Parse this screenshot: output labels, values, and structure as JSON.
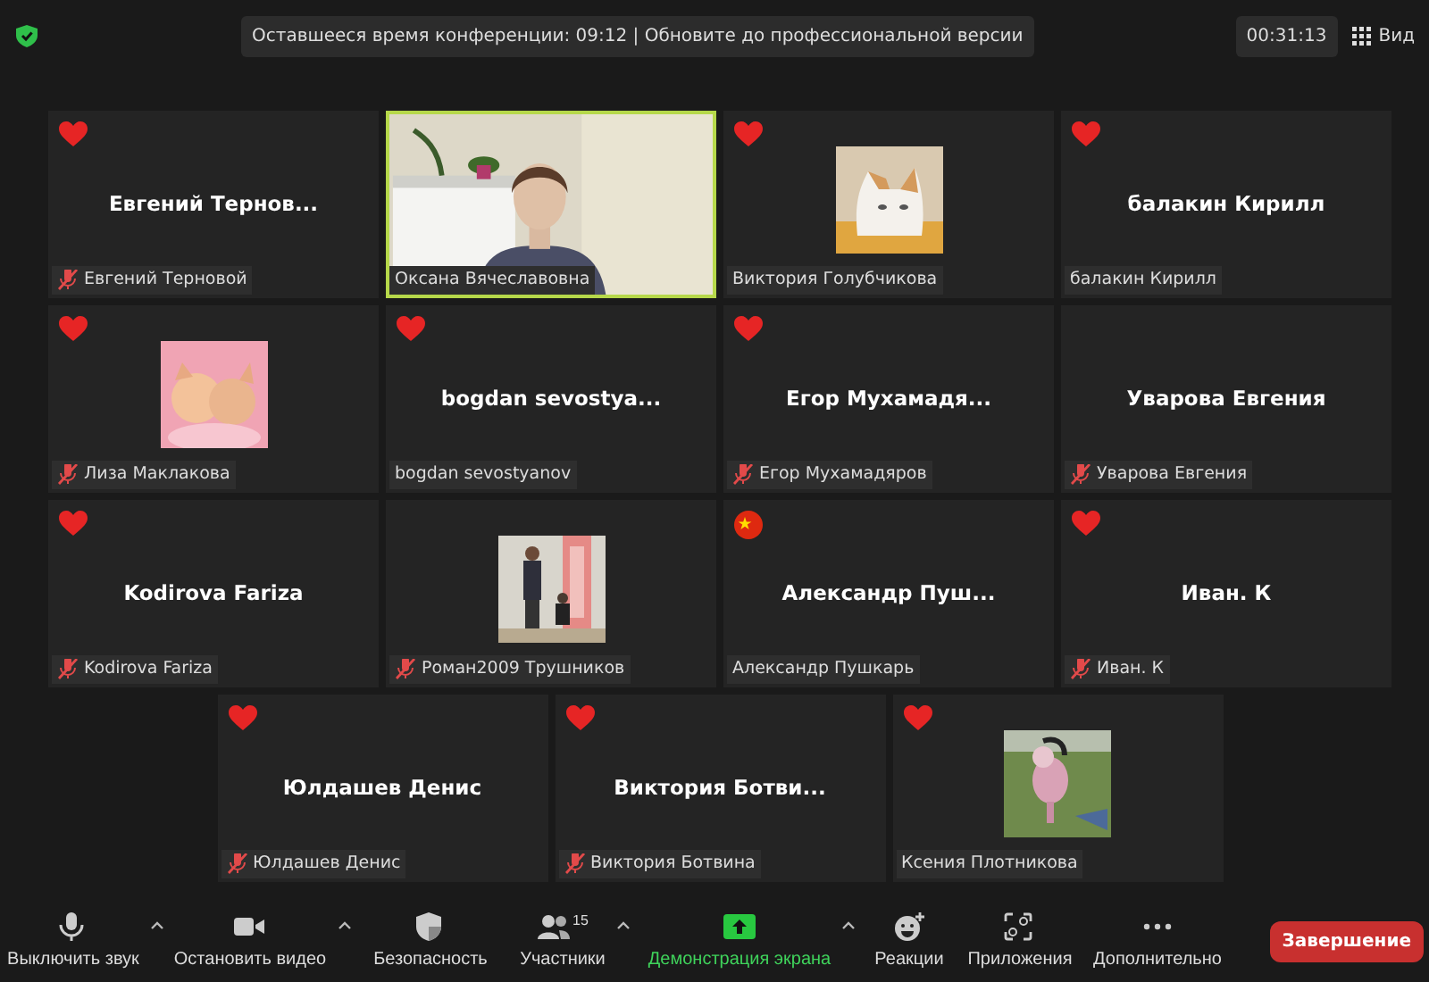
{
  "top_bar": {
    "notice": "Оставшееся время конференции: 09:12 | Обновите до профессиональной версии",
    "timer": "00:31:13",
    "view_label": "Вид"
  },
  "tiles": [
    {
      "kind": "name",
      "display_name": "Евгений  Тернов...",
      "label": "Евгений Терновой",
      "reaction": {
        "kind": "heart"
      },
      "muted": true,
      "selected": false
    },
    {
      "kind": "video",
      "label": "Оксана Вячеславовна",
      "muted": false,
      "selected": true
    },
    {
      "kind": "picture",
      "label": "Виктория Голубчикова",
      "reaction": {
        "kind": "heart"
      },
      "muted": false,
      "selected": false
    },
    {
      "kind": "name",
      "display_name": "балакин Кирилл",
      "label": "балакин Кирилл",
      "reaction": {
        "kind": "heart"
      },
      "muted": false,
      "selected": false
    },
    {
      "kind": "picture",
      "label": "Лиза Маклакова",
      "reaction": {
        "kind": "heart"
      },
      "muted": true,
      "selected": false
    },
    {
      "kind": "name",
      "display_name": "bogdan sevostya...",
      "label": "bogdan sevostyanov",
      "reaction": {
        "kind": "heart"
      },
      "muted": false,
      "selected": false
    },
    {
      "kind": "name",
      "display_name": "Егор  Мухамадя...",
      "label": "Егор Мухамадяров",
      "reaction": {
        "kind": "heart"
      },
      "muted": true,
      "selected": false
    },
    {
      "kind": "name",
      "display_name": "Уварова Евгения",
      "label": "Уварова Евгения",
      "muted": true,
      "selected": false
    },
    {
      "kind": "name",
      "display_name": "Kodirova Fariza",
      "label": "Kodirova Fariza",
      "reaction": {
        "kind": "heart"
      },
      "muted": true,
      "selected": false
    },
    {
      "kind": "picture",
      "label": "Роман2009 Трушников",
      "muted": true,
      "selected": false
    },
    {
      "kind": "name",
      "display_name": "Александр  Пуш...",
      "label": "Александр Пушкарь",
      "reaction": {
        "kind": "flag"
      },
      "muted": false,
      "selected": false
    },
    {
      "kind": "name",
      "display_name": "Иван. К",
      "label": "Иван. К",
      "reaction": {
        "kind": "heart"
      },
      "muted": true,
      "selected": false
    },
    {
      "kind": "name",
      "display_name": "Юлдашев Денис",
      "label": "Юлдашев Денис",
      "reaction": {
        "kind": "heart"
      },
      "muted": true,
      "selected": false
    },
    {
      "kind": "name",
      "display_name": "Виктория  Ботви...",
      "label": "Виктория Ботвина",
      "reaction": {
        "kind": "heart"
      },
      "muted": true,
      "selected": false
    },
    {
      "kind": "picture",
      "label": "Ксения Плотникова",
      "reaction": {
        "kind": "heart"
      },
      "muted": false,
      "selected": false
    }
  ],
  "toolbar": [
    {
      "kind": "mic",
      "label": "Выключить звук",
      "caret": true
    },
    {
      "kind": "video",
      "label": "Остановить видео",
      "caret": true
    },
    {
      "kind": "security",
      "label": "Безопасность",
      "caret": false
    },
    {
      "kind": "participants",
      "label": "Участники",
      "count": "15",
      "caret": true
    },
    {
      "kind": "share",
      "label": "Демонстрация экрана",
      "caret": true
    },
    {
      "kind": "reactions",
      "label": "Реакции",
      "caret": false
    },
    {
      "kind": "apps",
      "label": "Приложения",
      "caret": false
    },
    {
      "kind": "more",
      "label": "Дополнительно",
      "caret": false
    }
  ],
  "end_button": "Завершение"
}
